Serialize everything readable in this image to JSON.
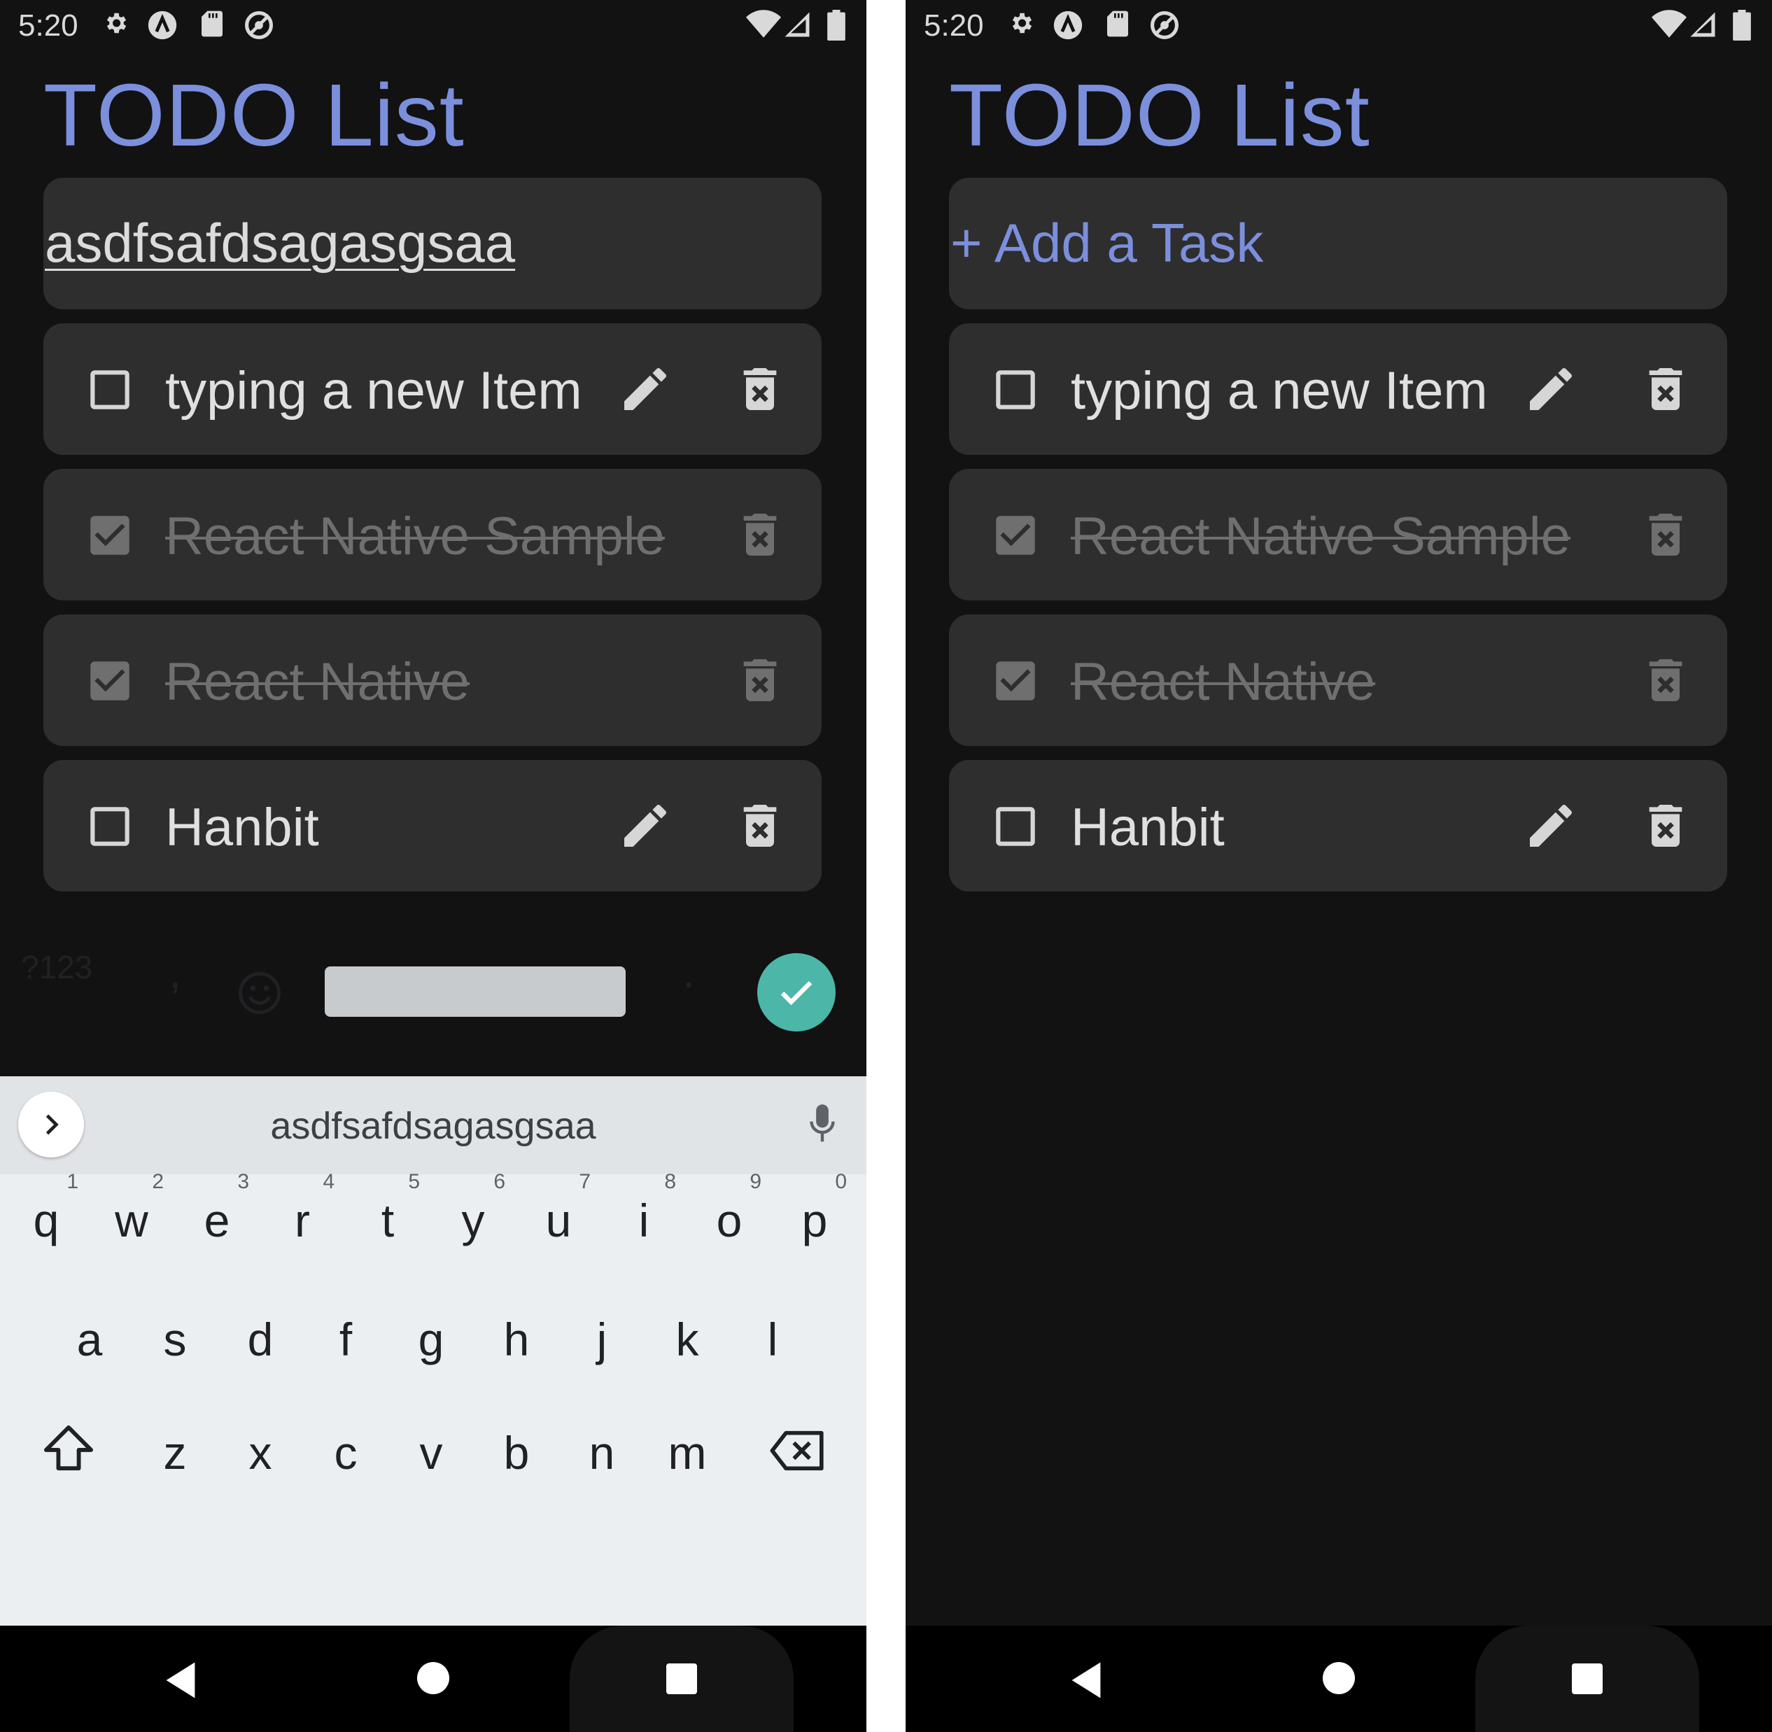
{
  "screens": [
    {
      "id": "left",
      "status_time": "5:20",
      "title": "TODO List",
      "input": {
        "value": "asdfsafdsagasgsaa",
        "placeholder": "+ Add a Task",
        "has_value": true
      },
      "tasks": [
        {
          "text": "typing a new Item",
          "completed": false
        },
        {
          "text": "React Native Sample",
          "completed": true
        },
        {
          "text": "React Native",
          "completed": true
        },
        {
          "text": "Hanbit",
          "completed": false
        }
      ],
      "keyboard_visible": true
    },
    {
      "id": "right",
      "status_time": "5:20",
      "title": "TODO List",
      "input": {
        "value": "",
        "placeholder": "+ Add a Task",
        "has_value": false
      },
      "tasks": [
        {
          "text": "typing a new Item",
          "completed": false
        },
        {
          "text": "React Native Sample",
          "completed": true
        },
        {
          "text": "React Native",
          "completed": true
        },
        {
          "text": "Hanbit",
          "completed": false
        }
      ],
      "keyboard_visible": false
    }
  ],
  "keyboard": {
    "suggestion": "asdfsafdsagasgsaa",
    "row1": [
      {
        "key": "q",
        "hint": "1"
      },
      {
        "key": "w",
        "hint": "2"
      },
      {
        "key": "e",
        "hint": "3"
      },
      {
        "key": "r",
        "hint": "4"
      },
      {
        "key": "t",
        "hint": "5"
      },
      {
        "key": "y",
        "hint": "6"
      },
      {
        "key": "u",
        "hint": "7"
      },
      {
        "key": "i",
        "hint": "8"
      },
      {
        "key": "o",
        "hint": "9"
      },
      {
        "key": "p",
        "hint": "0"
      }
    ],
    "row2": [
      "a",
      "s",
      "d",
      "f",
      "g",
      "h",
      "j",
      "k",
      "l"
    ],
    "row3": [
      "z",
      "x",
      "c",
      "v",
      "b",
      "n",
      "m"
    ],
    "symbols_label": "?123",
    "comma": ",",
    "period": "."
  },
  "icons": {
    "checkbox_empty": "checkbox-blank-icon",
    "checkbox_checked": "checkbox-checked-icon",
    "edit": "pencil-icon",
    "delete": "trash-icon"
  },
  "colors": {
    "background": "#121212",
    "card": "#2e2e2e",
    "accent": "#7b8fdc",
    "text": "#e0e0e0",
    "completed_text": "#6f6f6f",
    "keyboard_enter": "#4cb6a8"
  }
}
